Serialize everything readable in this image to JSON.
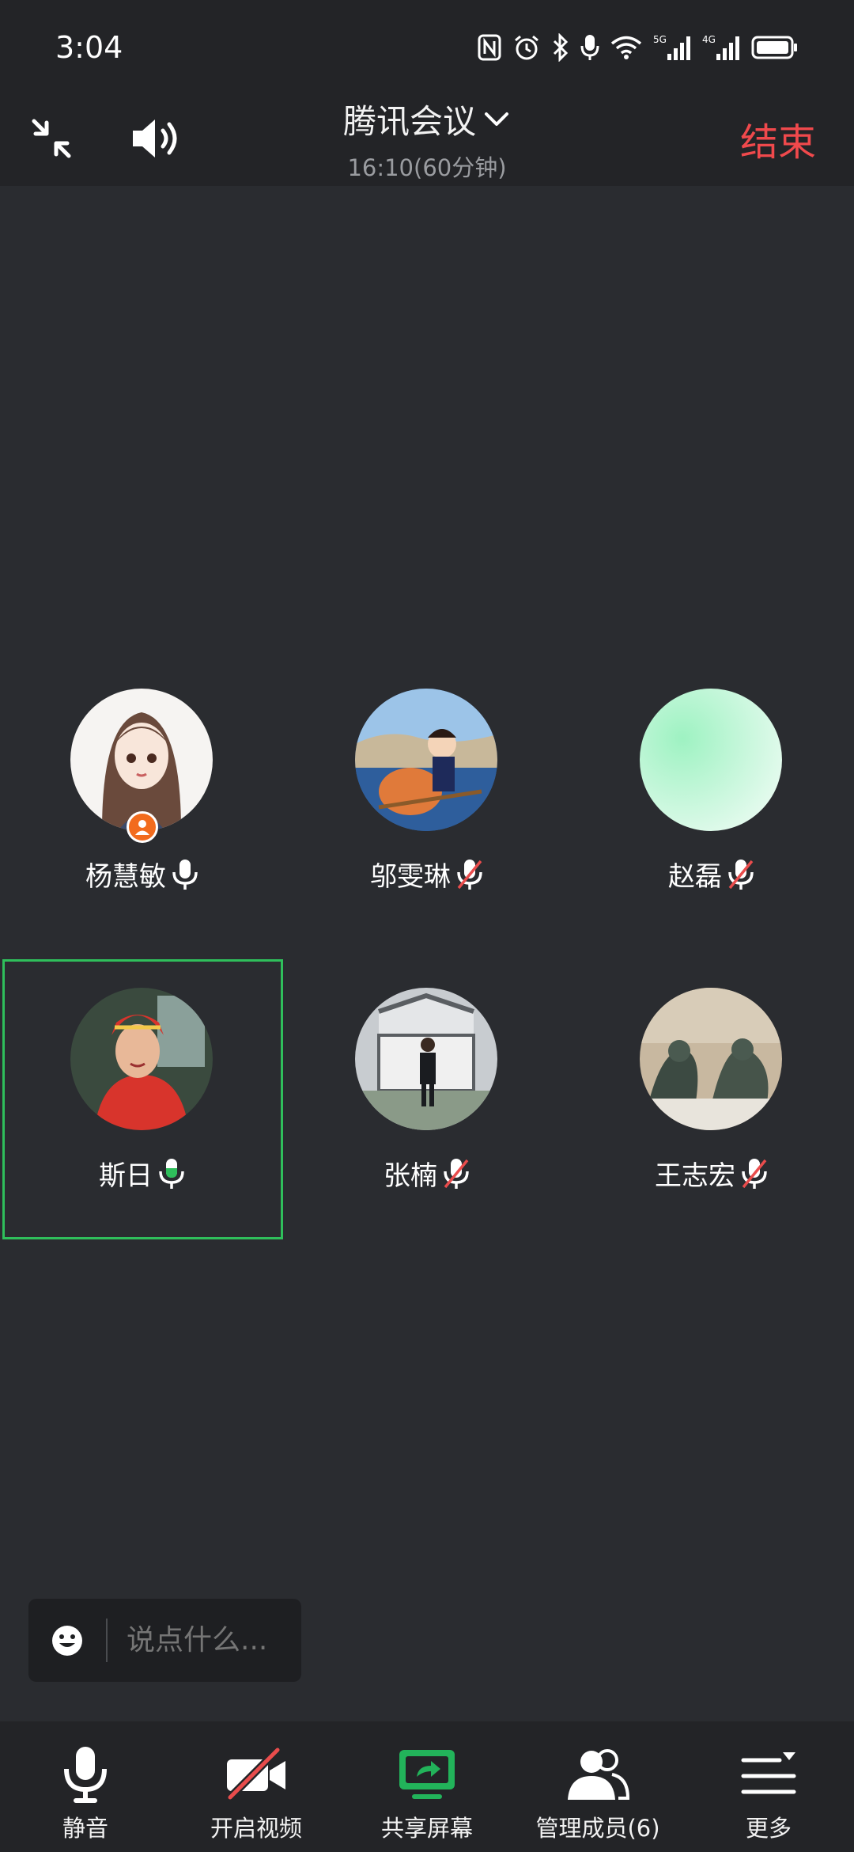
{
  "status_bar": {
    "time": "3:04",
    "icons": [
      "nfc-icon",
      "alarm-icon",
      "bluetooth-icon",
      "mic-icon",
      "wifi-icon",
      "signal-5g-icon",
      "signal-4g-icon",
      "battery-icon"
    ],
    "network_5g": "5G",
    "network_4g": "4G"
  },
  "header": {
    "title": "腾讯会议",
    "subtitle": "16:10(60分钟)",
    "end_label": "结束"
  },
  "participants": [
    {
      "name": "杨慧敏",
      "mic": "on",
      "host": true,
      "avatar_color": "#f4f2f0"
    },
    {
      "name": "邬雯琳",
      "mic": "muted",
      "host": false,
      "avatar_color": "#3e6ea8"
    },
    {
      "name": "赵磊",
      "mic": "muted",
      "host": false,
      "avatar_color": "#a8f0c8"
    },
    {
      "name": "斯日",
      "mic": "speaking",
      "host": false,
      "avatar_color": "#c8382e"
    },
    {
      "name": "张楠",
      "mic": "muted",
      "host": false,
      "avatar_color": "#8a8e92"
    },
    {
      "name": "王志宏",
      "mic": "muted",
      "host": false,
      "avatar_color": "#6a7068"
    }
  ],
  "chat": {
    "placeholder": "说点什么..."
  },
  "toolbar": {
    "mute_label": "静音",
    "video_label": "开启视频",
    "share_label": "共享屏幕",
    "members_label": "管理成员(6)",
    "more_label": "更多"
  },
  "colors": {
    "end_red": "#f0494c",
    "speaking_green": "#2fbf5b",
    "share_green": "#22b35a",
    "mute_red": "#e94c4c"
  }
}
